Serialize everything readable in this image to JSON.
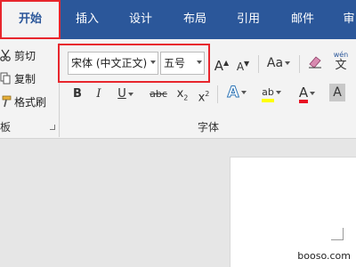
{
  "tabs": [
    {
      "label": "开始",
      "active": true
    },
    {
      "label": "插入"
    },
    {
      "label": "设计"
    },
    {
      "label": "布局"
    },
    {
      "label": "引用"
    },
    {
      "label": "邮件"
    },
    {
      "label": "审"
    }
  ],
  "clipboard": {
    "cut_label": "剪切",
    "copy_label": "复制",
    "format_painter_label": "格式刷",
    "group_label": "板"
  },
  "font": {
    "name_value": "宋体 (中文正文)",
    "size_value": "五号",
    "grow_label": "A",
    "shrink_label": "A",
    "case_label": "Aa",
    "phonetic_label": "wén",
    "bold_label": "B",
    "italic_label": "I",
    "underline_label": "U",
    "strike_label": "abc",
    "subscript_label": "x",
    "subscript_sub": "2",
    "superscript_label": "x",
    "superscript_sup": "2",
    "effects_label": "A",
    "highlight_label": "ab",
    "color_label": "A",
    "shade_label": "A",
    "group_label": "字体"
  },
  "colors": {
    "ribbon_blue": "#2b579a",
    "highlight_box": "#e8262d",
    "font_color_red": "#e81123",
    "highlight_yellow": "#ffff00",
    "effects_blue": "#2e75b6"
  },
  "watermark": "booso.com"
}
